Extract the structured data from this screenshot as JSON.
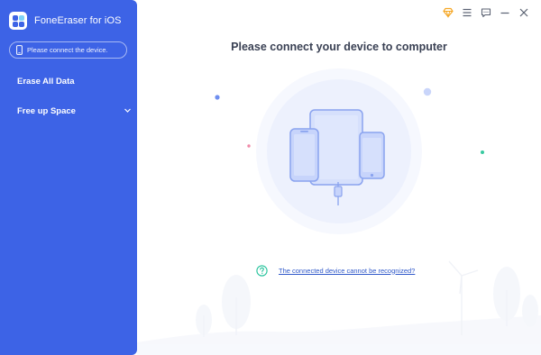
{
  "app": {
    "title": "FoneEraser for iOS"
  },
  "sidebar": {
    "device_status": "Please connect the device.",
    "items": [
      {
        "label": "Erase All Data"
      },
      {
        "label": "Free up Space",
        "icon": "chevron-down-icon"
      }
    ]
  },
  "titlebar": {
    "buttons": [
      {
        "name": "premium-diamond-button",
        "icon": "diamond-icon"
      },
      {
        "name": "menu-button",
        "icon": "hamburger-icon"
      },
      {
        "name": "feedback-button",
        "icon": "chat-icon"
      },
      {
        "name": "minimize-button",
        "icon": "minus-icon"
      },
      {
        "name": "close-button",
        "icon": "close-icon"
      }
    ]
  },
  "main": {
    "heading": "Please connect your device to computer",
    "help_link": "The connected device cannot be recognized?",
    "help_icon": "question-circle-icon"
  },
  "colors": {
    "sidebar": "#3d63e6",
    "accent": "#3d63e6",
    "device_fill": "#c7d4fb",
    "device_stroke": "#8aa3ef",
    "help_icon": "#22c29a",
    "premium_icon": "#f5a623"
  }
}
